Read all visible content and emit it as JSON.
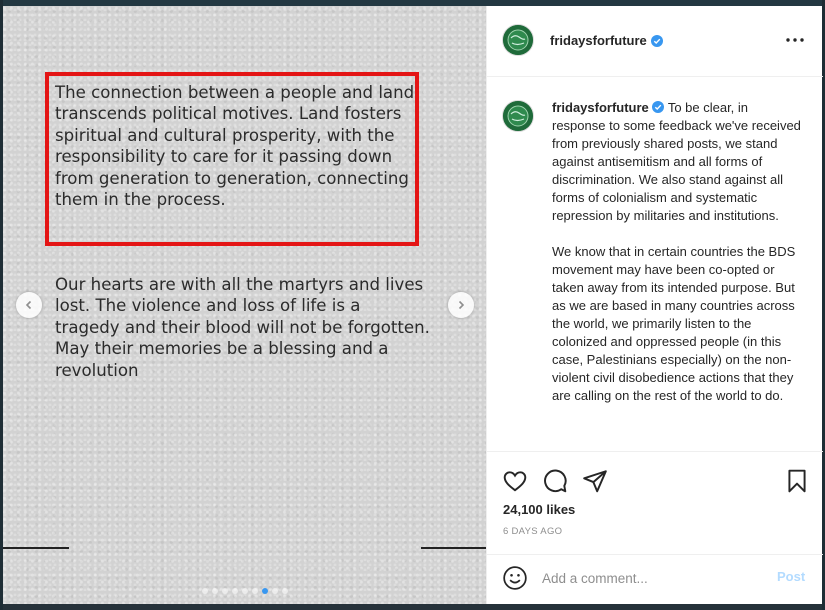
{
  "post": {
    "slide_text": {
      "paragraph_1": "The connection between a people and land transcends political motives. Land fosters spiritual and cultural prosperity, with the responsibility to care for it passing down from generation to generation, connecting them in the process.",
      "paragraph_2": "Our hearts are with all the martyrs and lives lost. The violence and loss of life is a tragedy and their blood will not be forgotten. May their memories be a blessing and a revolution"
    },
    "carousel": {
      "total_slides": 9,
      "active_index": 6
    },
    "highlight_color": "#e41515"
  },
  "header": {
    "username": "fridaysforfuture",
    "verified": true
  },
  "caption": {
    "username": "fridaysforfuture",
    "paragraph_1": "To be clear, in response to some feedback we've received from previously shared posts, we stand against antisemitism and all forms of discrimination. We also stand against all forms of colonialism and systematic repression by militaries and institutions.",
    "paragraph_2": "We know that in certain countries the BDS movement may have been co-opted or taken away from its intended purpose. But as we are based in many countries across the world, we primarily listen to the colonized and oppressed people (in this case, Palestinians especially) on the non-violent civil disobedience actions that they are calling on the rest of the world to do."
  },
  "actions": {
    "icons": [
      "heart-icon",
      "comment-icon",
      "share-icon",
      "bookmark-icon"
    ],
    "likes": "24,100 likes",
    "timestamp": "6 DAYS AGO"
  },
  "comment_box": {
    "placeholder": "Add a comment...",
    "post_label": "Post"
  },
  "colors": {
    "accent_blue": "#3897f0",
    "post_button_disabled": "#b3dbff",
    "avatar_green": "#1f6b3a"
  }
}
